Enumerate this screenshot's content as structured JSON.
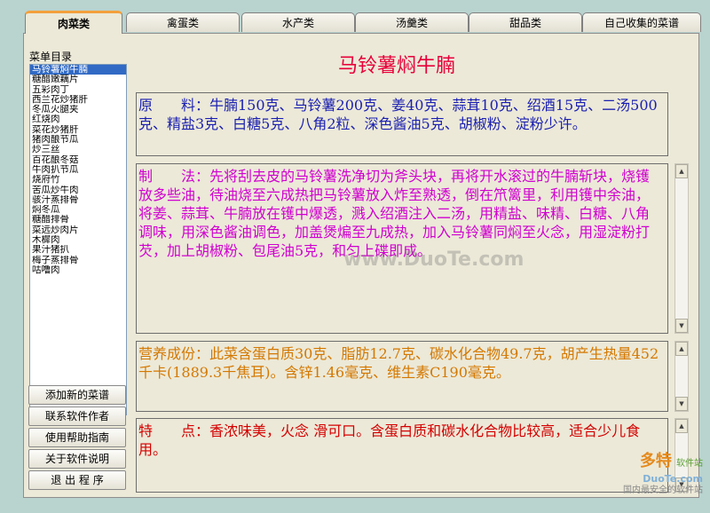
{
  "tabs": [
    {
      "label": "肉菜类",
      "active": true
    },
    {
      "label": "禽蛋类",
      "active": false
    },
    {
      "label": "水产类",
      "active": false
    },
    {
      "label": "汤羹类",
      "active": false
    },
    {
      "label": "甜品类",
      "active": false
    },
    {
      "label": "自己收集的菜谱",
      "active": false
    }
  ],
  "sidebar": {
    "menu_label": "菜单目录",
    "items": [
      "马铃薯焖牛腩",
      "糖醋嫩藕片",
      "五彩肉丁",
      "西兰花炒猪肝",
      "冬瓜火腿夹",
      "红烧肉",
      "菜花炒猪肝",
      "猪肉酿节瓜",
      "炒三丝",
      "百花酿冬菇",
      "牛肉扒节瓜",
      "烧府竹",
      "苦瓜炒牛肉",
      "骇汁蒸排骨",
      "焖冬瓜",
      "糖醋排骨",
      "菜远炒肉片",
      "木樨肉",
      "果汁猪扒",
      "梅子蒸排骨",
      "咕噜肉"
    ],
    "selected_index": 0,
    "buttons": [
      "添加新的菜谱",
      "联系软件作者",
      "使用帮助指南",
      "关于软件说明",
      "退 出 程 序"
    ]
  },
  "dish": {
    "title": "马铃薯焖牛腩",
    "ingredients": "原　　料：牛腩150克、马铃薯200克、姜40克、蒜茸10克、绍酒15克、二汤500克、精盐3克、白糖5克、八角2粒、深色酱油5克、胡椒粉、淀粉少许。",
    "method": "制　　法：先将刮去皮的马铃薯洗净切为斧头块，再将开水滚过的牛腩斩块，烧镬放多些油，待油烧至六成热把马铃薯放入炸至熟透，倒在笊篱里，利用镬中余油，将姜、蒜茸、牛腩放在镬中爆透，溅入绍酒注入二汤，用精盐、味精、白糖、八角调味，用深色酱油调色，加盖煲煸至九成热，加入马铃薯同焖至火念，用湿淀粉打芡，加上胡椒粉、包尾油5克，和匀上碟即成。",
    "nutrition": "营养成份：此菜含蛋白质30克、脂肪12.7克、碳水化合物49.7克，胡产生热量452千卡(1889.3千焦耳)。含锌1.46毫克、维生素C190毫克。",
    "features": "特　　点：香浓味美，火念 滑可口。含蛋白质和碳水化合物比较高，适合少儿食用。"
  },
  "colors": {
    "title": "#e8003a",
    "ingredients": "#1a1fb0",
    "method": "#d000d0",
    "nutrition": "#d47800",
    "features": "#d40000"
  },
  "watermark": {
    "center": "www.DuoTe.com",
    "logo_main": "多特",
    "logo_sub": "软件站",
    "logo_en": "DuoTe.com",
    "logo_tag": "国内最安全的软件站"
  }
}
